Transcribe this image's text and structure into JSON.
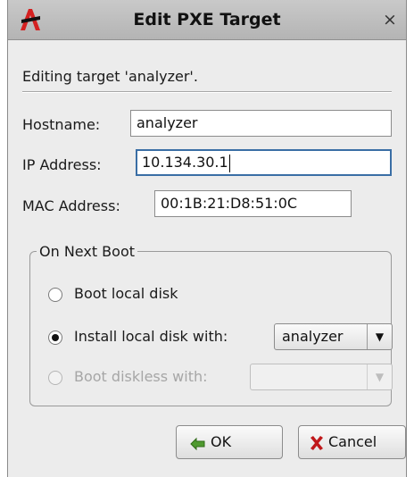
{
  "window": {
    "title": "Edit PXE Target",
    "close_glyph": "×"
  },
  "info_text": "Editing target 'analyzer'.",
  "fields": {
    "hostname": {
      "label": "Hostname:",
      "value": "analyzer"
    },
    "ip": {
      "label": "IP Address:",
      "value": "10.134.30.1"
    },
    "mac": {
      "label": "MAC Address:",
      "value": "00:1B:21:D8:51:0C"
    }
  },
  "boot": {
    "group_title": "On Next Boot",
    "options": [
      {
        "label": "Boot local disk",
        "checked": false,
        "enabled": true
      },
      {
        "label": "Install local disk with:",
        "checked": true,
        "enabled": true
      },
      {
        "label": "Boot diskless with:",
        "checked": false,
        "enabled": false
      }
    ],
    "install_image": "analyzer",
    "diskless_image": ""
  },
  "buttons": {
    "ok": "OK",
    "cancel": "Cancel"
  },
  "icons": {
    "app": "app-logo-icon",
    "close": "close-icon",
    "ok": "check-arrow-icon",
    "cancel": "red-x-icon",
    "dropdown": "chevron-down-icon"
  },
  "colors": {
    "app_logo": "#d42020",
    "ok_icon": "#4f9a2f",
    "cancel_icon": "#c0181a",
    "focus": "#3a6ea5"
  }
}
